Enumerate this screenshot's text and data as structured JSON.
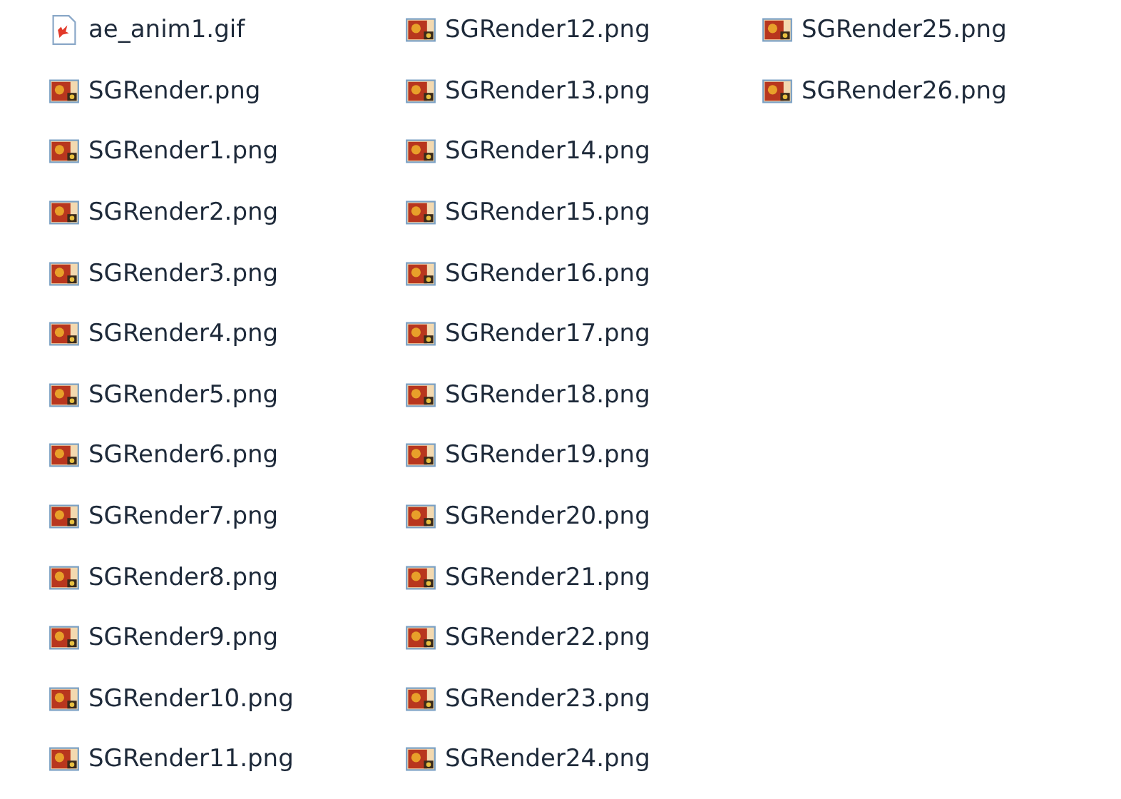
{
  "files": [
    {
      "name": "ae_anim1.gif",
      "kind": "gif"
    },
    {
      "name": "SGRender.png",
      "kind": "png"
    },
    {
      "name": "SGRender1.png",
      "kind": "png"
    },
    {
      "name": "SGRender2.png",
      "kind": "png"
    },
    {
      "name": "SGRender3.png",
      "kind": "png"
    },
    {
      "name": "SGRender4.png",
      "kind": "png"
    },
    {
      "name": "SGRender5.png",
      "kind": "png"
    },
    {
      "name": "SGRender6.png",
      "kind": "png"
    },
    {
      "name": "SGRender7.png",
      "kind": "png"
    },
    {
      "name": "SGRender8.png",
      "kind": "png"
    },
    {
      "name": "SGRender9.png",
      "kind": "png"
    },
    {
      "name": "SGRender10.png",
      "kind": "png"
    },
    {
      "name": "SGRender11.png",
      "kind": "png"
    },
    {
      "name": "SGRender12.png",
      "kind": "png"
    },
    {
      "name": "SGRender13.png",
      "kind": "png"
    },
    {
      "name": "SGRender14.png",
      "kind": "png"
    },
    {
      "name": "SGRender15.png",
      "kind": "png"
    },
    {
      "name": "SGRender16.png",
      "kind": "png"
    },
    {
      "name": "SGRender17.png",
      "kind": "png"
    },
    {
      "name": "SGRender18.png",
      "kind": "png"
    },
    {
      "name": "SGRender19.png",
      "kind": "png"
    },
    {
      "name": "SGRender20.png",
      "kind": "png"
    },
    {
      "name": "SGRender21.png",
      "kind": "png"
    },
    {
      "name": "SGRender22.png",
      "kind": "png"
    },
    {
      "name": "SGRender23.png",
      "kind": "png"
    },
    {
      "name": "SGRender24.png",
      "kind": "png"
    },
    {
      "name": "SGRender25.png",
      "kind": "png"
    },
    {
      "name": "SGRender26.png",
      "kind": "png"
    }
  ]
}
